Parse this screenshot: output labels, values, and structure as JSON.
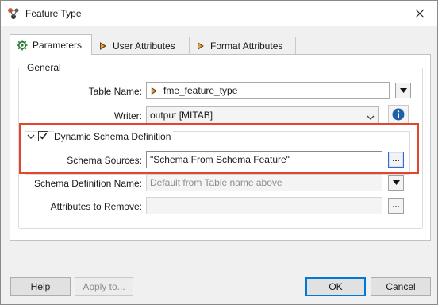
{
  "window": {
    "title": "Feature Type"
  },
  "tabs": [
    {
      "label": "Parameters",
      "icon": "gear-icon"
    },
    {
      "label": "User Attributes",
      "icon": "attribute-arrow-icon"
    },
    {
      "label": "Format Attributes",
      "icon": "attribute-arrow-icon"
    }
  ],
  "general": {
    "title": "General",
    "table_name": {
      "label": "Table Name:",
      "value": "fme_feature_type"
    },
    "writer": {
      "label": "Writer:",
      "value": "output [MITAB]"
    },
    "dynamic_schema": {
      "label": "Dynamic Schema Definition",
      "checked": true,
      "schema_sources": {
        "label": "Schema Sources:",
        "value": "\"Schema From Schema Feature\"",
        "button": "..."
      }
    },
    "schema_definition_name": {
      "label": "Schema Definition Name:",
      "placeholder": "Default from Table name above"
    },
    "attributes_to_remove": {
      "label": "Attributes to Remove:",
      "value": "",
      "button": "..."
    }
  },
  "buttons": {
    "help": "Help",
    "apply": "Apply to...",
    "ok": "OK",
    "cancel": "Cancel"
  },
  "colors": {
    "highlight": "#e2462c",
    "accent": "#0078d7",
    "info": "#1f5fa8"
  }
}
